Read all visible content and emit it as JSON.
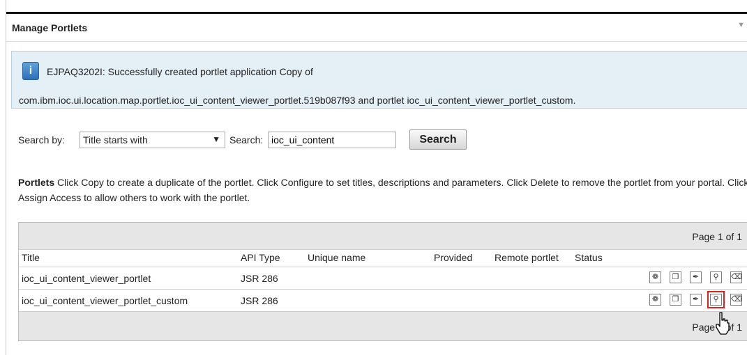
{
  "header": {
    "title": "Manage Portlets",
    "menu_icon": "chevron-down-icon"
  },
  "message": {
    "icon": "info-icon",
    "line1": "EJPAQ3202I: Successfully created portlet application Copy of",
    "line2": "com.ibm.ioc.ui.location.map.portlet.ioc_ui_content_viewer_portlet.519b087f93 and portlet ioc_ui_content_viewer_portlet_custom."
  },
  "search": {
    "by_label": "Search by:",
    "by_value": "Title starts with",
    "search_label": "Search:",
    "query": "ioc_ui_content",
    "button": "Search"
  },
  "description": {
    "heading": "Portlets",
    "text": " Click Copy to create a duplicate of the portlet. Click Configure to set titles, descriptions and parameters. Click Delete to remove the portlet from your portal. Click Assign Access to allow others to work with the portlet."
  },
  "table": {
    "pager_top": "Page 1 of 1",
    "pager_bottom": "Page 1 of 1",
    "columns": [
      "Title",
      "API Type",
      "Unique name",
      "Provided",
      "Remote portlet",
      "Status"
    ],
    "rows": [
      {
        "title": "ioc_ui_content_viewer_portlet",
        "api_type": "JSR 286",
        "unique_name": "",
        "provided": "",
        "remote": "",
        "status": ""
      },
      {
        "title": "ioc_ui_content_viewer_portlet_custom",
        "api_type": "JSR 286",
        "unique_name": "",
        "provided": "",
        "remote": "",
        "status": ""
      }
    ],
    "action_icons": [
      "copy-settings-icon",
      "copy-icon",
      "configure-icon",
      "assign-access-icon",
      "delete-icon"
    ]
  },
  "colors": {
    "highlight": "#e0201f",
    "message_bg": "#e4eff6",
    "info_icon": "#3a7fc8"
  }
}
